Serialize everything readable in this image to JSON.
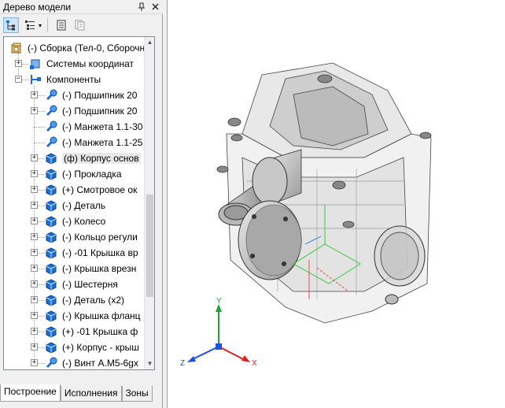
{
  "panel": {
    "title": "Дерево модели",
    "pin_icon": "pin-icon",
    "close_icon": "close-icon"
  },
  "toolbar": {
    "buttons": [
      "tree-structure-icon",
      "tree-view-mode-icon",
      "document-properties-icon",
      "document-copy-icon"
    ]
  },
  "tree": {
    "root": "(-) Сборка (Тел-0, Сборочн",
    "items": [
      {
        "label": "Системы координат",
        "icon": "coordinate-systems-icon"
      },
      {
        "label": "Компоненты",
        "icon": "components-icon"
      },
      {
        "label": "(-) Подшипник 20",
        "icon": "standard-part-icon"
      },
      {
        "label": "(-) Подшипник 20",
        "icon": "standard-part-icon"
      },
      {
        "label": "(-) Манжета 1.1-30",
        "icon": "standard-part-icon"
      },
      {
        "label": "(-) Манжета 1.1-25",
        "icon": "standard-part-icon"
      },
      {
        "label": "(ф) Корпус основ",
        "icon": "part-icon"
      },
      {
        "label": "(-) Прокладка",
        "icon": "part-icon"
      },
      {
        "label": "(+) Смотровое ок",
        "icon": "part-icon"
      },
      {
        "label": "(-) Деталь",
        "icon": "part-icon"
      },
      {
        "label": "(-) Колесо",
        "icon": "part-icon"
      },
      {
        "label": "(-) Кольцо регули",
        "icon": "part-icon"
      },
      {
        "label": "(-) -01 Крышка вр",
        "icon": "part-icon"
      },
      {
        "label": "(-) Крышка врезн",
        "icon": "part-icon"
      },
      {
        "label": "(-) Шестерня",
        "icon": "part-icon"
      },
      {
        "label": "(-) Деталь (x2)",
        "icon": "part-icon"
      },
      {
        "label": "(-) Крышка фланц",
        "icon": "part-icon"
      },
      {
        "label": "(+) -01 Крышка ф",
        "icon": "part-icon"
      },
      {
        "label": "(+) Корпус - крыш",
        "icon": "part-icon"
      },
      {
        "label": "(-) Винт А.М5-6gx",
        "icon": "standard-part-icon"
      }
    ]
  },
  "tabs": [
    "Построение",
    "Исполнения",
    "Зоны"
  ],
  "axes": {
    "x": "X",
    "y": "Y",
    "z": "Z"
  },
  "colors": {
    "selection": "#cce4f7",
    "axis_x": "#e02020",
    "axis_y": "#20a040",
    "axis_z": "#2050e0",
    "part_icon": "#1a6fd6"
  }
}
